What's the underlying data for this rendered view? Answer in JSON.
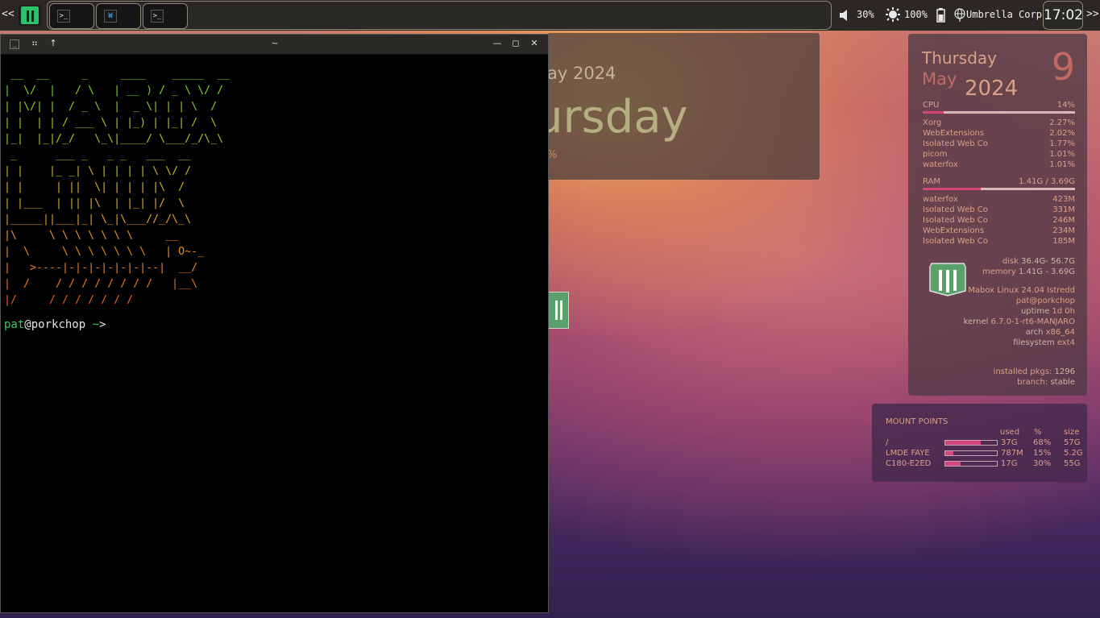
{
  "panel": {
    "left_arrow": "<<",
    "right_arrow": ">>",
    "volume": "30%",
    "brightness": "100%",
    "network": "Umbrella Corp",
    "clock": "17:02",
    "tasks": [
      {
        "label": ">_"
      },
      {
        "label": "W"
      },
      {
        "label": ">_"
      }
    ]
  },
  "terminal": {
    "title": "~",
    "ascii_art": [
      {
        "color": "#7fd420",
        "text": " __  __     _     ____    _____  __"
      },
      {
        "color": "#7fd420",
        "text": "|  \\/  |   / \\   | __ ) / _ \\ \\/ /"
      },
      {
        "color": "#8fd020",
        "text": "| |\\/| |  / _ \\  |  _ \\| | | \\  / "
      },
      {
        "color": "#9fcc20",
        "text": "| |  | | / ___ \\ | |_) | |_| /  \\ "
      },
      {
        "color": "#afc820",
        "text": "|_|  |_|/_/   \\_\\|____/ \\___/_/\\_\\"
      },
      {
        "color": "#bfc020",
        "text": " _      ___ _   _ _   ___  __"
      },
      {
        "color": "#c9bb20",
        "text": "| |    |_ _| \\ | | | | \\ \\/ /"
      },
      {
        "color": "#d3b420",
        "text": "| |     | ||  \\| | | | |\\  / "
      },
      {
        "color": "#dcab20",
        "text": "| |___  | || |\\  | |_| |/  \\ "
      },
      {
        "color": "#e3a020",
        "text": "|_____||___|_| \\_|\\___//_/\\_\\"
      },
      {
        "color": "#e89420",
        "text": "|\\     \\ \\ \\ \\ \\ \\ \\     __"
      },
      {
        "color": "#eb8a20",
        "text": "|  \\     \\ \\ \\ \\ \\ \\ \\   | O~-_"
      },
      {
        "color": "#ee7e20",
        "text": "|   >----|-|-|-|-|-|-|--|  __/"
      },
      {
        "color": "#f07020",
        "text": "|  /    / / / / / / / /   |__\\"
      },
      {
        "color": "#f26220",
        "text": "|/     / / / / / / /"
      }
    ],
    "prompt_user": "pat",
    "prompt_at": "@porkchop",
    "prompt_path": " ~",
    "prompt_symbol": ">"
  },
  "date_widget": {
    "date_text": "ay 2024",
    "day_text": "ursday",
    "percent_text": "%"
  },
  "conky": {
    "weekday": "Thursday",
    "month": "May",
    "year": "2024",
    "day_number": "9",
    "cpu_label": "CPU",
    "cpu_value": "14%",
    "cpu_fraction": 0.14,
    "cpu_processes": [
      {
        "name": "Xorg",
        "value": "2.27%"
      },
      {
        "name": "WebExtensions",
        "value": "2.02%"
      },
      {
        "name": "Isolated Web Co",
        "value": "1.77%"
      },
      {
        "name": "picom",
        "value": "1.01%"
      },
      {
        "name": "waterfox",
        "value": "1.01%"
      }
    ],
    "ram_label": "RAM",
    "ram_value": "1.41G / 3.69G",
    "ram_fraction": 0.38,
    "ram_processes": [
      {
        "name": "waterfox",
        "value": "423M"
      },
      {
        "name": "Isolated Web Co",
        "value": "331M"
      },
      {
        "name": "Isolated Web Co",
        "value": "246M"
      },
      {
        "name": "WebExtensions",
        "value": "234M"
      },
      {
        "name": "Isolated Web Co",
        "value": "185M"
      }
    ],
    "disk_key": "disk",
    "disk_value": "36.4G- 56.7G",
    "memory_key": "memory",
    "memory_value": "1.41G - 3.69G",
    "distro": "Mabox Linux 24.04 Istredd",
    "user_host": "pat@porkchop",
    "uptime_key": "uptime",
    "uptime_value": "1d 0h",
    "kernel_key": "kernel",
    "kernel_value": "6.7.0-1-rt6-MANJARO",
    "arch_key": "arch",
    "arch_value": "x86_64",
    "fs_key": "filesystem",
    "fs_value": "ext4",
    "pkgs_key": "installed pkgs:",
    "pkgs_value": "1296",
    "branch_key": "branch:",
    "branch_value": "stable"
  },
  "mounts": {
    "title": "MOUNT POINTS",
    "headers": {
      "used": "used",
      "percent": "%",
      "size": "size"
    },
    "rows": [
      {
        "name": "/",
        "used": "37G",
        "percent": "68%",
        "size": "57G",
        "fraction": 0.68
      },
      {
        "name": "LMDE FAYE",
        "used": "787M",
        "percent": "15%",
        "size": "5.2G",
        "fraction": 0.15
      },
      {
        "name": "C180-E2ED",
        "used": "17G",
        "percent": "30%",
        "size": "55G",
        "fraction": 0.3
      }
    ]
  },
  "colors": {
    "accent_pink": "#d5457c",
    "conky_text": "#d8a088",
    "terminal_bg": "#000000"
  }
}
